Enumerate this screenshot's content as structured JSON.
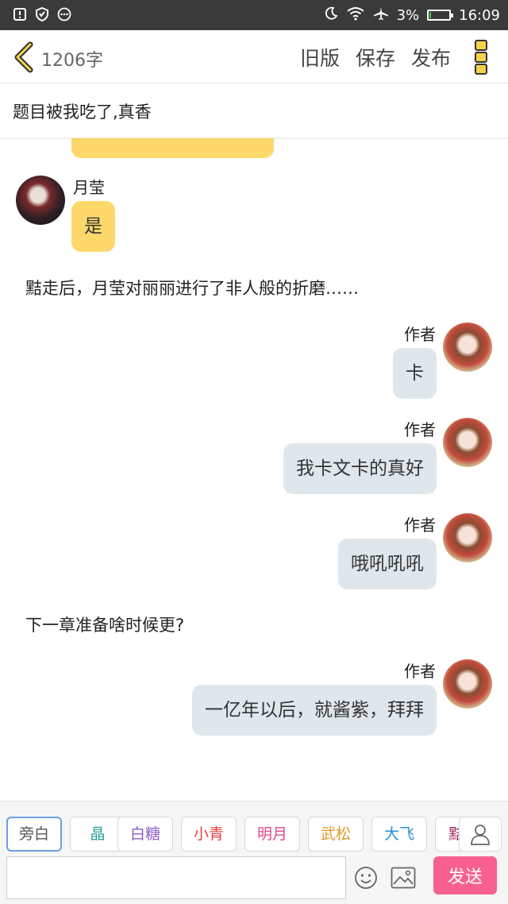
{
  "status_bar": {
    "battery_text": "3%",
    "battery_level": 0.03,
    "time": "16:09",
    "icons": [
      "alert-icon",
      "shield-icon",
      "more-icon",
      "moon-icon",
      "wifi-icon",
      "airplane-icon",
      "battery-icon"
    ]
  },
  "toolbar": {
    "word_count": "1206字",
    "old_version": "旧版",
    "save": "保存",
    "publish": "发布"
  },
  "chapter_title": "题目被我吃了,真香",
  "messages": {
    "m1": {
      "speaker": "月莹",
      "text": "是"
    },
    "n1": "黠走后，月莹对丽丽进行了非人般的折磨……",
    "m2": {
      "speaker": "作者",
      "text": "卡"
    },
    "m3": {
      "speaker": "作者",
      "text": "我卡文卡的真好"
    },
    "m4": {
      "speaker": "作者",
      "text": "哦吼吼吼"
    },
    "n2": "下一章准备啥时候更?",
    "m5": {
      "speaker": "作者",
      "text": "一亿年以后，就酱紫，拜拜"
    }
  },
  "roles": [
    {
      "label": "旁白",
      "color": "#555555"
    },
    {
      "label": "晶",
      "color": "#2aa39a"
    },
    {
      "label": "白糖",
      "color": "#8e5bc9"
    },
    {
      "label": "小青",
      "color": "#e0413a"
    },
    {
      "label": "明月",
      "color": "#e0478c"
    },
    {
      "label": "武松",
      "color": "#e09a2a"
    },
    {
      "label": "大飞",
      "color": "#2a8fd6"
    },
    {
      "label": "黠",
      "color": "#a0285c"
    }
  ],
  "input": {
    "value": "",
    "placeholder": ""
  },
  "send_label": "发送",
  "colors": {
    "left_bubble": "#fdd96b",
    "right_bubble": "#dfe7ec",
    "send_button": "#f7608f",
    "accent": "#f5d24d"
  }
}
